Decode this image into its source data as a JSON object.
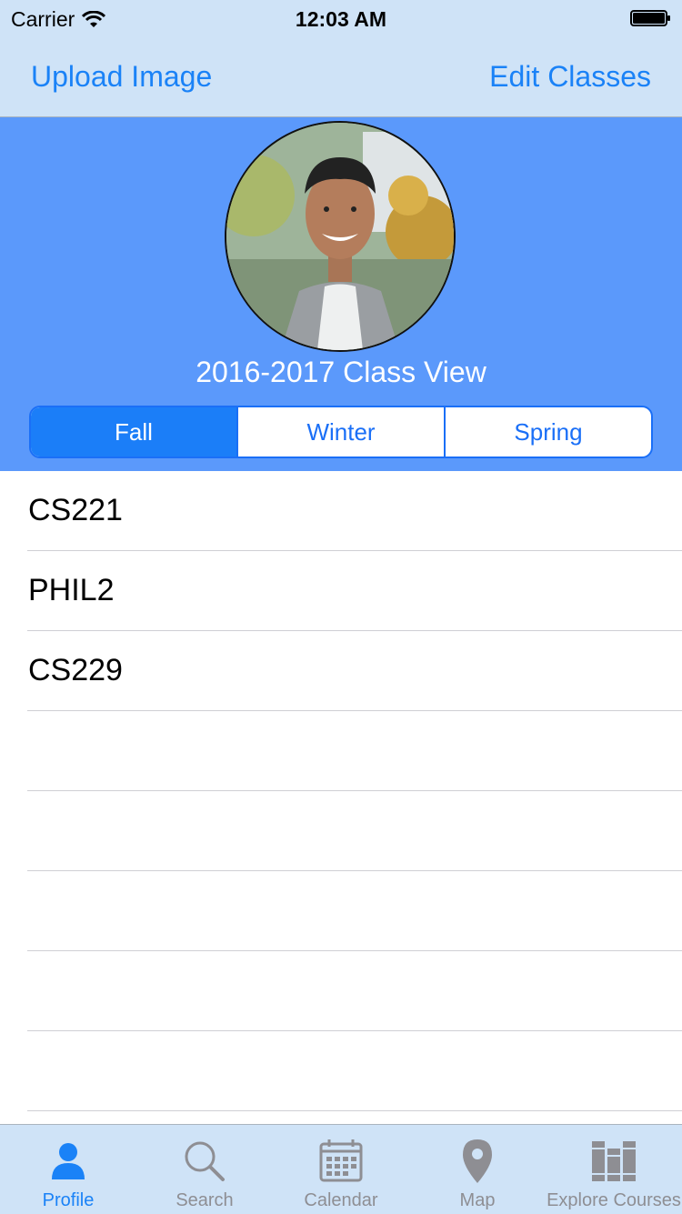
{
  "status_bar": {
    "carrier": "Carrier",
    "time": "12:03 AM"
  },
  "nav": {
    "left_label": "Upload Image",
    "right_label": "Edit Classes"
  },
  "profile": {
    "class_view_title": "2016-2017 Class View"
  },
  "segments": [
    {
      "label": "Fall",
      "selected": true
    },
    {
      "label": "Winter",
      "selected": false
    },
    {
      "label": "Spring",
      "selected": false
    }
  ],
  "classes": [
    "CS221",
    "PHIL2",
    "CS229",
    "",
    "",
    "",
    "",
    ""
  ],
  "tabs": [
    {
      "label": "Profile",
      "icon": "person-icon",
      "active": true
    },
    {
      "label": "Search",
      "icon": "magnifier-icon",
      "active": false
    },
    {
      "label": "Calendar",
      "icon": "calendar-icon",
      "active": false
    },
    {
      "label": "Map",
      "icon": "map-pin-icon",
      "active": false
    },
    {
      "label": "Explore Courses",
      "icon": "books-icon",
      "active": false
    }
  ],
  "colors": {
    "accent": "#1a82f7",
    "header_background": "#5b99fb",
    "bar_background": "#cfe3f7",
    "inactive_tab": "#8e8e93"
  }
}
